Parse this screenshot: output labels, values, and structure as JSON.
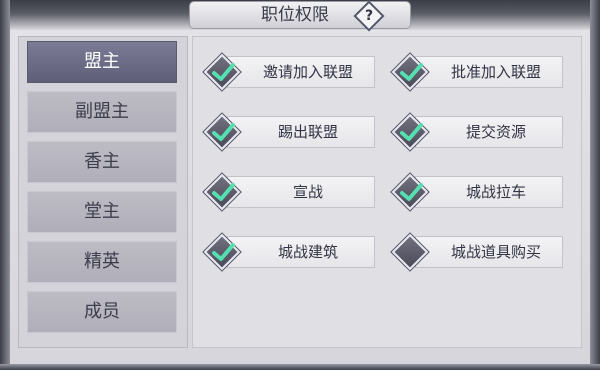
{
  "title": "职位权限",
  "help_icon": "question-mark-icon",
  "roles": [
    {
      "label": "盟主",
      "active": true
    },
    {
      "label": "副盟主",
      "active": false
    },
    {
      "label": "香主",
      "active": false
    },
    {
      "label": "堂主",
      "active": false
    },
    {
      "label": "精英",
      "active": false
    },
    {
      "label": "成员",
      "active": false
    }
  ],
  "permissions": [
    {
      "label": "邀请加入联盟",
      "checked": true
    },
    {
      "label": "批准加入联盟",
      "checked": true
    },
    {
      "label": "踢出联盟",
      "checked": true
    },
    {
      "label": "提交资源",
      "checked": true
    },
    {
      "label": "宣战",
      "checked": true
    },
    {
      "label": "城战拉车",
      "checked": true
    },
    {
      "label": "城战建筑",
      "checked": true
    },
    {
      "label": "城战道具购买",
      "checked": false
    }
  ],
  "colors": {
    "check": "#55e0b0",
    "active_role": "#6d6c86"
  }
}
